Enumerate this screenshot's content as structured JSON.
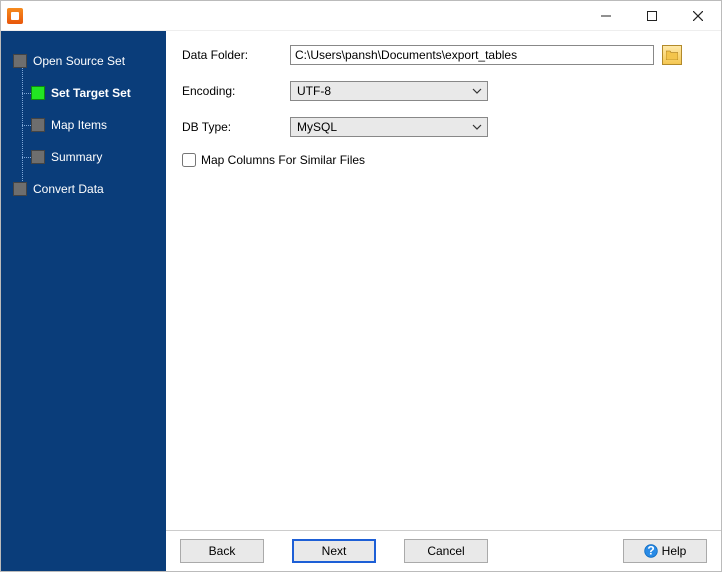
{
  "window": {
    "minimize": "—",
    "maximize": "☐",
    "close": "✕"
  },
  "sidebar": {
    "items": [
      {
        "label": "Open Source Set",
        "active": false,
        "child": false
      },
      {
        "label": "Set Target Set",
        "active": true,
        "child": true
      },
      {
        "label": "Map Items",
        "active": false,
        "child": true
      },
      {
        "label": "Summary",
        "active": false,
        "child": true
      },
      {
        "label": "Convert Data",
        "active": false,
        "child": false
      }
    ]
  },
  "form": {
    "data_folder_label": "Data Folder:",
    "data_folder_value": "C:\\Users\\pansh\\Documents\\export_tables",
    "encoding_label": "Encoding:",
    "encoding_value": "UTF-8",
    "db_type_label": "DB Type:",
    "db_type_value": "MySQL",
    "map_columns_label": "Map Columns For Similar Files",
    "map_columns_checked": false
  },
  "footer": {
    "back": "Back",
    "next": "Next",
    "cancel": "Cancel",
    "help": "Help"
  }
}
